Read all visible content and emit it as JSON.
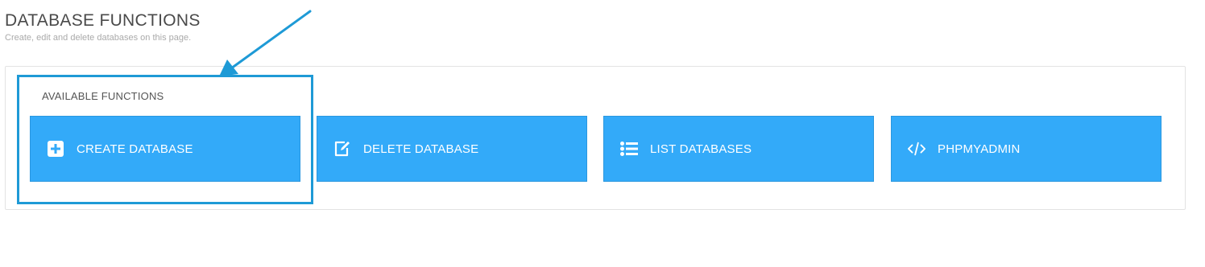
{
  "header": {
    "title": "DATABASE FUNCTIONS",
    "subtitle": "Create, edit and delete databases on this page."
  },
  "panel": {
    "section_label": "AVAILABLE FUNCTIONS",
    "buttons": [
      {
        "label": "CREATE DATABASE",
        "icon": "plus-square-icon"
      },
      {
        "label": "DELETE DATABASE",
        "icon": "edit-icon"
      },
      {
        "label": "LIST DATABASES",
        "icon": "list-icon"
      },
      {
        "label": "PHPMYADMIN",
        "icon": "code-icon"
      }
    ]
  },
  "colors": {
    "button_bg": "#33aaf9",
    "annotation": "#1e9ad6"
  }
}
